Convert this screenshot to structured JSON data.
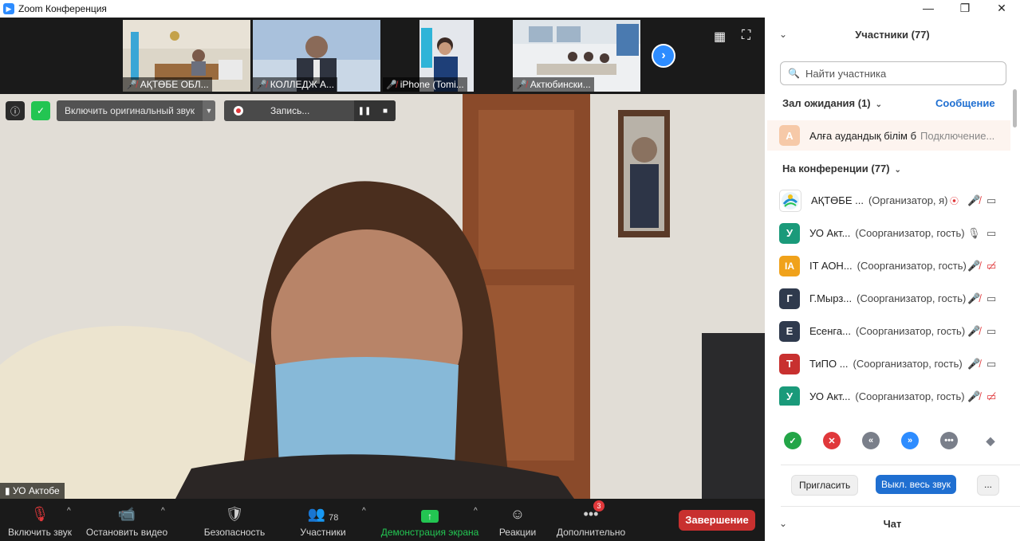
{
  "window": {
    "title": "Zoom Конференция",
    "controls": {
      "minimize": "—",
      "maximize": "❐",
      "close": "✕"
    }
  },
  "thumbnails": [
    {
      "label": "АҚТӨБЕ ОБЛ..."
    },
    {
      "label": "КОЛЛЕДЖ А..."
    },
    {
      "label": "iPhone (Tomi..."
    },
    {
      "label": "Актюбински..."
    }
  ],
  "video": {
    "original_sound_button": "Включить оригинальный звук",
    "recording_label": "Запись...",
    "speaker_name": "УО Актобе"
  },
  "toolbar": {
    "unmute": "Включить звук",
    "stop_video": "Остановить видео",
    "security": "Безопасность",
    "participants": "Участники",
    "participants_count": "78",
    "share_screen": "Демонстрация экрана",
    "reactions": "Реакции",
    "more": "Дополнительно",
    "more_badge": "3",
    "end": "Завершение"
  },
  "panel": {
    "title": "Участники (77)",
    "search_placeholder": "Найти участника",
    "waiting_room_label": "Зал ожидания (1)",
    "message_link": "Сообщение",
    "waiting": {
      "avatar": "А",
      "name": "Алға аудандық білім б",
      "status": "Подключение..."
    },
    "in_meeting_label": "На конференции (77)",
    "participants": [
      {
        "avatar": "",
        "name": "АҚТӨБЕ ...",
        "role": "(Организатор, я)"
      },
      {
        "avatar": "У",
        "name": "УО Акт...",
        "role": "(Соорганизатор, гость)"
      },
      {
        "avatar": "IA",
        "name": "IT АОН...",
        "role": "(Соорганизатор, гость)"
      },
      {
        "avatar": "Г",
        "name": "Г.Мырз...",
        "role": "(Соорганизатор, гость)"
      },
      {
        "avatar": "Е",
        "name": "Есенга...",
        "role": "(Соорганизатор, гость)"
      },
      {
        "avatar": "Т",
        "name": "ТиПО ...",
        "role": "(Соорганизатор, гость)"
      },
      {
        "avatar": "У",
        "name": "УО Акт...",
        "role": "(Соорганизатор, гость)"
      }
    ],
    "invite": "Пригласить",
    "mute_all": "Выкл. весь звук",
    "more": "...",
    "chat_title": "Чат"
  },
  "colors": {
    "accent": "#2d8cff",
    "end_red": "#c8302f",
    "share_green": "#23c552",
    "mute_red": "#e0383b"
  }
}
